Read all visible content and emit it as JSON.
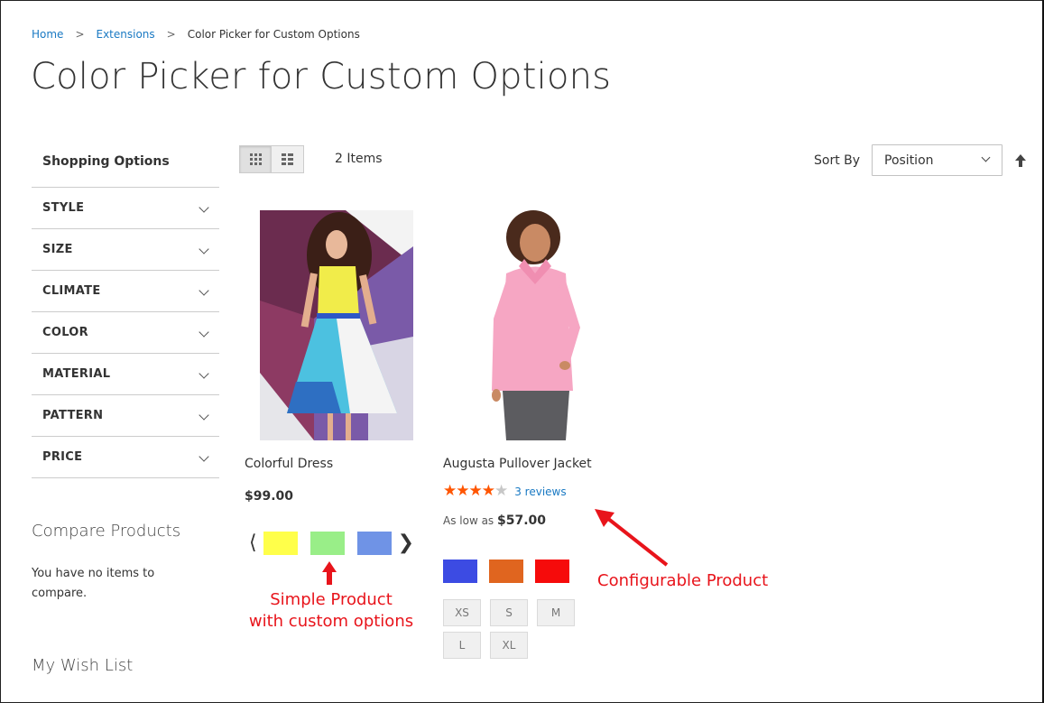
{
  "breadcrumb": {
    "home": "Home",
    "extensions": "Extensions",
    "current": "Color Picker for Custom Options",
    "separator": ">"
  },
  "page_title": "Color Picker for Custom Options",
  "sidebar": {
    "title": "Shopping Options",
    "filters": [
      {
        "label": "STYLE"
      },
      {
        "label": "SIZE"
      },
      {
        "label": "CLIMATE"
      },
      {
        "label": "COLOR"
      },
      {
        "label": "MATERIAL"
      },
      {
        "label": "PATTERN"
      },
      {
        "label": "PRICE"
      }
    ],
    "compare_title": "Compare Products",
    "compare_empty": "You have no items to compare.",
    "wishlist_title": "My Wish List"
  },
  "toolbar": {
    "items_count": "2 Items",
    "sort_label": "Sort By",
    "sort_value": "Position",
    "view_modes": [
      "grid-icon",
      "list-icon"
    ],
    "active_mode": "grid"
  },
  "products": [
    {
      "name": "Colorful Dress",
      "price": "$99.00",
      "swatches": [
        "#ffff4a",
        "#99ee88",
        "#6f93e6"
      ],
      "prev_arrow": "⟨",
      "next_arrow": "❯"
    },
    {
      "name": "Augusta Pullover Jacket",
      "rating": 4,
      "rating_max": 5,
      "reviews": "3 reviews",
      "price_prefix": "As low as",
      "price": "$57.00",
      "colors": [
        "#3c4be3",
        "#e0651f",
        "#f60b0b"
      ],
      "sizes": [
        "XS",
        "S",
        "M",
        "L",
        "XL"
      ]
    }
  ],
  "annotations": {
    "simple_line1": "Simple Product",
    "simple_line2": "with custom options",
    "configurable": "Configurable Product",
    "color": "#e8141b"
  },
  "colors": {
    "link": "#1979c3",
    "star": "#ff5501"
  }
}
